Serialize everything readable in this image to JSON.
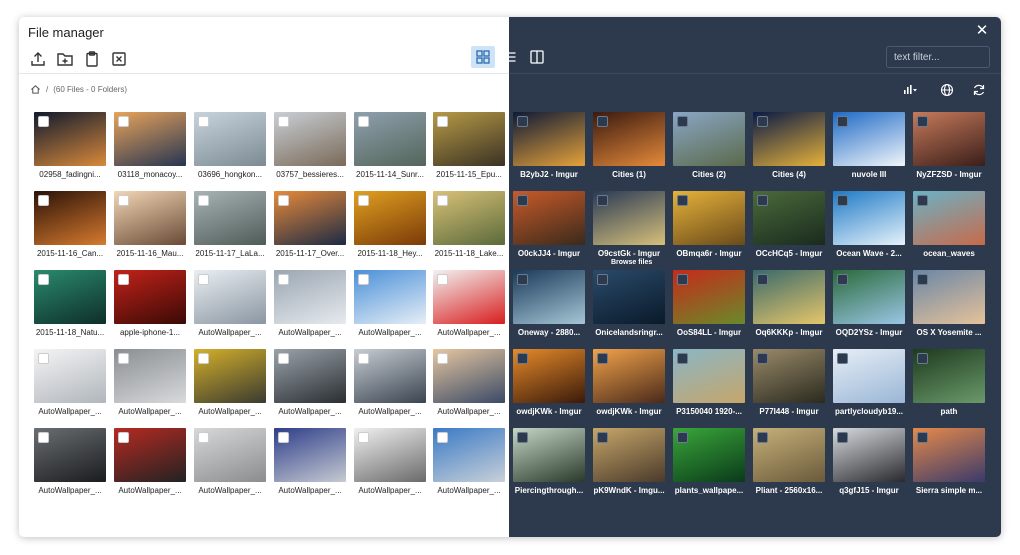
{
  "app": {
    "title": "File manager"
  },
  "toolbar": {
    "upload_icon": "upload-icon",
    "new_folder_icon": "folder-plus-icon",
    "paste_icon": "clipboard-icon",
    "delete_icon": "x-square-icon",
    "grid_view_icon": "grid-icon",
    "list_view_icon": "list-icon",
    "split_view_icon": "columns-icon"
  },
  "search": {
    "placeholder": "text filter..."
  },
  "breadcrumb": {
    "separator": "/",
    "summary": "(60 Files - 0 Folders)"
  },
  "tooltip": "Browse files",
  "colors": {
    "dark_panel": "#2d3a4d",
    "active_button": "#cfe3f7"
  },
  "files": [
    {
      "name": "02958_fadingni...",
      "c1": "#101a2e",
      "c2": "#d9893a"
    },
    {
      "name": "03118_monacoy...",
      "c1": "#e8a35a",
      "c2": "#263552"
    },
    {
      "name": "03696_hongkon...",
      "c1": "#c7d4de",
      "c2": "#7c8a92"
    },
    {
      "name": "03757_bessieres...",
      "c1": "#c9cfd6",
      "c2": "#7a6a58"
    },
    {
      "name": "2015-11-14_Sunr...",
      "c1": "#8fa0ae",
      "c2": "#53655a"
    },
    {
      "name": "2015-11-15_Epu...",
      "c1": "#b79a46",
      "c2": "#3a3224"
    },
    {
      "name": "2015-11-16_Can...",
      "c1": "#2a1208",
      "c2": "#d77a2e"
    },
    {
      "name": "2015-11-16_Mau...",
      "c1": "#f2d6b5",
      "c2": "#6a4a36"
    },
    {
      "name": "2015-11-17_LaLa...",
      "c1": "#a8b3b5",
      "c2": "#4e5c58"
    },
    {
      "name": "2015-11-17_Over...",
      "c1": "#e88a3a",
      "c2": "#1c2a44"
    },
    {
      "name": "2015-11-18_Hey...",
      "c1": "#e0a020",
      "c2": "#7a3a08"
    },
    {
      "name": "2015-11-18_Lake...",
      "c1": "#d9c178",
      "c2": "#5a6a3a"
    },
    {
      "name": "2015-11-18_Natu...",
      "c1": "#2a8a6e",
      "c2": "#0e2e2a"
    },
    {
      "name": "apple-iphone-1...",
      "c1": "#c2221a",
      "c2": "#3a0a06"
    },
    {
      "name": "AutoWallpaper_...",
      "c1": "#e9eef2",
      "c2": "#8a96a2"
    },
    {
      "name": "AutoWallpaper_...",
      "c1": "#9aa6b2",
      "c2": "#e6eaee"
    },
    {
      "name": "AutoWallpaper_...",
      "c1": "#4a90d8",
      "c2": "#e6eef6"
    },
    {
      "name": "AutoWallpaper_...",
      "c1": "#f2f2f2",
      "c2": "#d81e1e"
    },
    {
      "name": "AutoWallpaper_...",
      "c1": "#f4f4f4",
      "c2": "#b0b6bc"
    },
    {
      "name": "AutoWallpaper_...",
      "c1": "#8a8e92",
      "c2": "#d8dadc"
    },
    {
      "name": "AutoWallpaper_...",
      "c1": "#d4b02a",
      "c2": "#3a3a30"
    },
    {
      "name": "AutoWallpaper_...",
      "c1": "#9aa2aa",
      "c2": "#2a2e32"
    },
    {
      "name": "AutoWallpaper_...",
      "c1": "#c6ccd2",
      "c2": "#3a4450"
    },
    {
      "name": "AutoWallpaper_...",
      "c1": "#e6c6a0",
      "c2": "#3a4a66"
    },
    {
      "name": "AutoWallpaper_...",
      "c1": "#6a6e72",
      "c2": "#1a1c1e"
    },
    {
      "name": "AutoWallpaper_...",
      "c1": "#b62a22",
      "c2": "#222222"
    },
    {
      "name": "AutoWallpaper_...",
      "c1": "#d6d8da",
      "c2": "#8a8c8e"
    },
    {
      "name": "AutoWallpaper_...",
      "c1": "#2e3e8a",
      "c2": "#c6cad2"
    },
    {
      "name": "AutoWallpaper_...",
      "c1": "#f0f0f0",
      "c2": "#6a6a6a"
    },
    {
      "name": "AutoWallpaper_...",
      "c1": "#3a7ac6",
      "c2": "#c8d0d8"
    },
    {
      "name": "B2ybJ2 - Imgur",
      "c1": "#0e1a36",
      "c2": "#e6a23a"
    },
    {
      "name": "Cities (1)",
      "c1": "#3a1a10",
      "c2": "#e68a3a"
    },
    {
      "name": "Cities (2)",
      "c1": "#8aa6c6",
      "c2": "#5a6a4a"
    },
    {
      "name": "Cities (4)",
      "c1": "#0a1a46",
      "c2": "#e6b23a"
    },
    {
      "name": "nuvole III",
      "c1": "#1e6ac6",
      "c2": "#f2f6fa"
    },
    {
      "name": "NyZFZSD - Imgur",
      "c1": "#c67a5a",
      "c2": "#3a1e1a"
    },
    {
      "name": "O0ckJJ4 - Imgur",
      "c1": "#c85a2a",
      "c2": "#3a2a1a"
    },
    {
      "name": "O9cstGk - Imgur",
      "c1": "#2a3a56",
      "c2": "#d6c07a"
    },
    {
      "name": "OBmqa6r - Imgur",
      "c1": "#e6b23a",
      "c2": "#6a4a1a"
    },
    {
      "name": "OCcHCq5 - Imgur",
      "c1": "#4a6a3a",
      "c2": "#1a2a1e"
    },
    {
      "name": "Ocean Wave - 2...",
      "c1": "#1e7ac6",
      "c2": "#e6f2fa"
    },
    {
      "name": "ocean_waves",
      "c1": "#6ab2c6",
      "c2": "#c86a4a"
    },
    {
      "name": "Oneway - 2880...",
      "c1": "#1a3a5a",
      "c2": "#a6c6d6"
    },
    {
      "name": "Onicelandsringr...",
      "c1": "#2a4a6a",
      "c2": "#0a1a2a"
    },
    {
      "name": "OoS84LL - Imgur",
      "c1": "#c62a1a",
      "c2": "#6a8a2a"
    },
    {
      "name": "Oq6KKKp - Imgur",
      "c1": "#3a6a6a",
      "c2": "#e6c66a"
    },
    {
      "name": "OQD2YSz - Imgur",
      "c1": "#2a6a3a",
      "c2": "#9ac6e6"
    },
    {
      "name": "OS X Yosemite ...",
      "c1": "#6a86a6",
      "c2": "#e6c29a"
    },
    {
      "name": "owdjKWk - Imgur",
      "c1": "#e68a2a",
      "c2": "#3a1a0a"
    },
    {
      "name": "owdjKWk - Imgur",
      "c1": "#f2a24a",
      "c2": "#4a2a1a"
    },
    {
      "name": "P3150040 1920-...",
      "c1": "#8ab6c6",
      "c2": "#c6a66a"
    },
    {
      "name": "P77I448 - Imgur",
      "c1": "#9a8a6a",
      "c2": "#2a2a1e"
    },
    {
      "name": "partlycloudyb19...",
      "c1": "#e6eef6",
      "c2": "#9ab6d6"
    },
    {
      "name": "path",
      "c1": "#1e3a1e",
      "c2": "#6a9a6a"
    },
    {
      "name": "Piercingthrough...",
      "c1": "#c6d6c6",
      "c2": "#2a3a2a"
    },
    {
      "name": "pK9WndK - Imgu...",
      "c1": "#c6a66a",
      "c2": "#4a3a2a"
    },
    {
      "name": "plants_wallpape...",
      "c1": "#3aa63a",
      "c2": "#0a3a1a"
    },
    {
      "name": "Pliant - 2560x16...",
      "c1": "#c6b07a",
      "c2": "#6a5a3a"
    },
    {
      "name": "q3gfJ15 - Imgur",
      "c1": "#d6dade",
      "c2": "#2a2a2e"
    },
    {
      "name": "Sierra simple m...",
      "c1": "#e68a4a",
      "c2": "#3a3a6a"
    }
  ]
}
